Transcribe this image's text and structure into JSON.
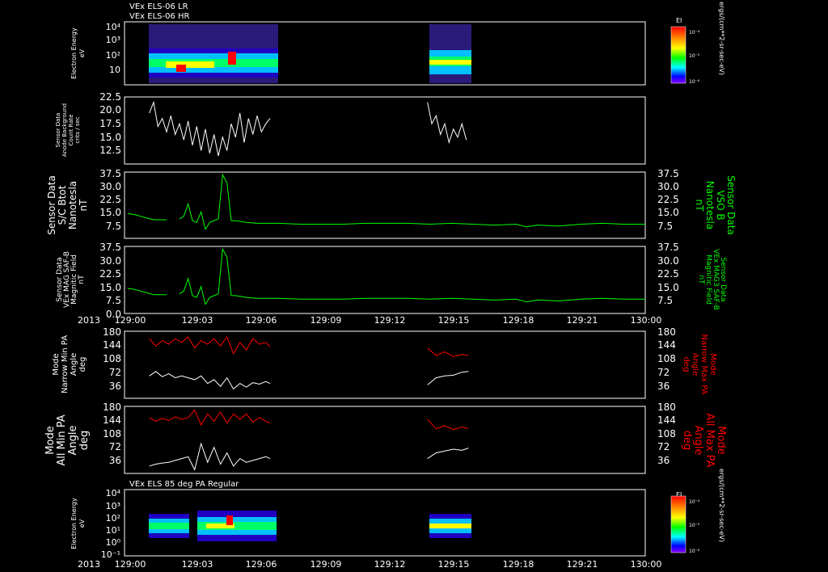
{
  "titles": {
    "top1": "VEx ELS-06 LR",
    "top2": "VEx ELS-06 HR",
    "mid": "VEx ELS 85 deg PA Regular"
  },
  "colors": {
    "white": "#ffffff",
    "green": "#00ff00",
    "red": "#ff0000",
    "background": "#000000"
  },
  "colorbar": {
    "title": "EI",
    "ticks": [
      "10⁻⁴",
      "10⁻⁵",
      "10⁻⁶"
    ],
    "unit_label": "ergs/(cm**2-sr-sec-eV)"
  },
  "time_axis": {
    "year": "2013",
    "ticks": [
      "129:00",
      "129:03",
      "129:06",
      "129:09",
      "129:12",
      "129:15",
      "129:18",
      "129:21",
      "130:00"
    ]
  },
  "chart_data": [
    {
      "type": "heatmap",
      "name": "electron-spectrogram-top",
      "ylabel_lines": [
        "Electron Energy",
        "eV"
      ],
      "y_scale": "log",
      "yticks": [
        "10⁴",
        "10³",
        "10²",
        "10",
        ""
      ],
      "data_intervals": [
        [
          "129:01",
          "129:07"
        ],
        [
          "129:14",
          "129:16"
        ]
      ],
      "colorbar": "EI"
    },
    {
      "type": "line",
      "name": "anode-background",
      "ylabel_lines": [
        "Sensor Data",
        "Anode Background",
        "Count Rate",
        "cnts / sec"
      ],
      "yticks": [
        "22.5",
        "20.0",
        "17.5",
        "15.0",
        "12.5"
      ],
      "ylim": [
        10.0,
        22.5
      ],
      "color": "#ffffff",
      "segments": [
        {
          "t": [
            1.0,
            1.2,
            1.4,
            1.6,
            1.8,
            2.0,
            2.2,
            2.4,
            2.6,
            2.8,
            3.0,
            3.2,
            3.4,
            3.6,
            3.8,
            4.0,
            4.2,
            4.4,
            4.6,
            4.8,
            5.0,
            5.2,
            5.4,
            5.6,
            5.8,
            6.0,
            6.2,
            6.4,
            6.6
          ],
          "v": [
            19.5,
            21.5,
            17.0,
            18.5,
            16.0,
            19.0,
            15.5,
            17.5,
            14.5,
            18.0,
            13.5,
            17.0,
            12.5,
            16.5,
            12.0,
            15.5,
            11.5,
            15.0,
            12.5,
            17.5,
            15.0,
            19.5,
            14.0,
            18.5,
            15.5,
            19.0,
            16.0,
            17.5,
            18.5
          ]
        },
        {
          "t": [
            13.9,
            14.1,
            14.3,
            14.5,
            14.7,
            14.9,
            15.1,
            15.3,
            15.5,
            15.7
          ],
          "v": [
            21.5,
            17.5,
            19.0,
            15.5,
            17.5,
            14.0,
            16.5,
            15.0,
            17.5,
            14.5
          ]
        }
      ]
    },
    {
      "type": "line",
      "name": "sc-btot",
      "ylabel_lines": [
        "Sensor Data",
        "S/C Btot",
        "Nanotesla",
        "nT"
      ],
      "ylabel_right_lines": [
        "Sensor Data",
        "VSO B",
        "Nanotesla",
        "nT"
      ],
      "yticks": [
        "37.5",
        "30.0",
        "22.5",
        "15.0",
        "7.5"
      ],
      "ylim": [
        0,
        37.5
      ],
      "color": "#00ff00",
      "segments": [
        {
          "t": [
            0.0,
            0.3,
            0.6,
            0.9,
            1.2,
            1.5,
            1.8
          ],
          "v": [
            14.0,
            13.5,
            12.5,
            11.5,
            10.5,
            10.5,
            10.5
          ]
        },
        {
          "t": [
            2.4,
            2.6,
            2.8,
            3.0,
            3.2,
            3.4,
            3.6
          ],
          "v": [
            11.0,
            12.5,
            19.5,
            10.0,
            9.0,
            15.0,
            5.0
          ]
        },
        {
          "t": [
            3.6,
            3.8,
            4.0,
            4.2,
            4.4,
            4.6,
            4.8,
            5.0,
            5.5,
            6.0,
            7.0,
            8.0,
            9.0,
            10.0,
            11.0,
            12.0,
            13.0,
            14.0,
            15.0,
            16.0,
            17.0,
            18.0,
            18.5,
            19.0,
            20.0,
            21.0,
            22.0,
            23.0,
            24.0
          ],
          "v": [
            5.0,
            9.0,
            10.0,
            11.0,
            36.0,
            31.5,
            10.0,
            10.0,
            9.0,
            8.5,
            8.5,
            8.0,
            8.0,
            8.0,
            8.5,
            8.5,
            8.5,
            8.0,
            8.5,
            8.0,
            7.5,
            8.0,
            6.5,
            7.5,
            7.0,
            8.0,
            8.5,
            8.0,
            8.0
          ]
        }
      ]
    },
    {
      "type": "line",
      "name": "vex-mag-saf-b",
      "ylabel_lines": [
        "Sensor Data",
        "VEx MAG SAF-B",
        "Magnitic Field",
        "nT"
      ],
      "ylabel_right_lines": [
        "Sensor Data",
        "VEx MAG3 SAF-B",
        "Magnitic Field",
        "nT"
      ],
      "yticks": [
        "37.5",
        "30.0",
        "22.5",
        "15.0",
        "7.5",
        "0.0"
      ],
      "ylim": [
        0,
        37.5
      ],
      "color": "#00ff00",
      "segments": [
        {
          "t": [
            0.0,
            0.3,
            0.6,
            0.9,
            1.2,
            1.5,
            1.8
          ],
          "v": [
            14.0,
            13.5,
            12.5,
            11.5,
            10.5,
            10.5,
            10.5
          ]
        },
        {
          "t": [
            2.4,
            2.6,
            2.8,
            3.0,
            3.2,
            3.4,
            3.6
          ],
          "v": [
            11.0,
            12.5,
            19.5,
            10.0,
            9.0,
            15.0,
            5.0
          ]
        },
        {
          "t": [
            3.6,
            3.8,
            4.0,
            4.2,
            4.4,
            4.6,
            4.8,
            5.0,
            5.5,
            6.0,
            7.0,
            8.0,
            9.0,
            10.0,
            11.0,
            12.0,
            13.0,
            14.0,
            15.0,
            16.0,
            17.0,
            18.0,
            18.5,
            19.0,
            20.0,
            21.0,
            22.0,
            23.0,
            24.0
          ],
          "v": [
            5.0,
            9.0,
            10.0,
            11.0,
            36.0,
            31.5,
            10.0,
            10.0,
            9.0,
            8.5,
            8.5,
            8.0,
            8.0,
            8.0,
            8.5,
            8.5,
            8.5,
            8.0,
            8.5,
            8.0,
            7.5,
            8.0,
            6.5,
            7.5,
            7.0,
            8.0,
            8.5,
            8.0,
            8.0
          ]
        }
      ]
    },
    {
      "type": "line",
      "name": "narrow-pa",
      "ylabel_lines": [
        "Mode",
        "Narrow Min PA",
        "Angle",
        "deg"
      ],
      "ylabel_right_lines": [
        "Mode",
        "Narrow Max PA",
        "Angle",
        "deg"
      ],
      "yticks": [
        "180",
        "144",
        "108",
        "72",
        "36"
      ],
      "ylim": [
        0,
        180
      ],
      "series": [
        {
          "color": "#ffffff",
          "segments": [
            {
              "t": [
                1.0,
                1.3,
                1.6,
                1.9,
                2.2,
                2.5,
                2.8,
                3.1,
                3.4,
                3.7,
                4.0,
                4.3,
                4.6,
                4.9,
                5.2,
                5.5,
                5.8,
                6.1,
                6.4,
                6.6
              ],
              "v": [
                60,
                72,
                58,
                66,
                55,
                60,
                55,
                50,
                60,
                40,
                50,
                32,
                55,
                25,
                40,
                30,
                42,
                38,
                45,
                40
              ]
            },
            {
              "t": [
                13.9,
                14.3,
                14.7,
                15.1,
                15.5,
                15.8
              ],
              "v": [
                36,
                55,
                60,
                62,
                70,
                72
              ]
            }
          ]
        },
        {
          "color": "#ff0000",
          "segments": [
            {
              "t": [
                1.0,
                1.3,
                1.6,
                1.9,
                2.2,
                2.5,
                2.8,
                3.1,
                3.4,
                3.7,
                4.0,
                4.3,
                4.6,
                4.9,
                5.2,
                5.5,
                5.8,
                6.1,
                6.4,
                6.6
              ],
              "v": [
                160,
                140,
                155,
                145,
                160,
                150,
                165,
                135,
                155,
                145,
                160,
                140,
                165,
                120,
                150,
                130,
                160,
                145,
                150,
                138
              ]
            },
            {
              "t": [
                13.9,
                14.3,
                14.7,
                15.1,
                15.5,
                15.8
              ],
              "v": [
                135,
                115,
                125,
                112,
                118,
                115
              ]
            }
          ]
        }
      ]
    },
    {
      "type": "line",
      "name": "all-pa",
      "ylabel_lines": [
        "Mode",
        "All Min PA",
        "Angle",
        "deg"
      ],
      "ylabel_right_lines": [
        "Mode",
        "All Max PA",
        "Angle",
        "deg"
      ],
      "yticks": [
        "180",
        "144",
        "108",
        "72",
        "36"
      ],
      "ylim": [
        0,
        180
      ],
      "series": [
        {
          "color": "#ffffff",
          "segments": [
            {
              "t": [
                1.0,
                1.3,
                1.6,
                1.9,
                2.2,
                2.5,
                2.8,
                3.1,
                3.4,
                3.7,
                4.0,
                4.3,
                4.6,
                4.9,
                5.2,
                5.5,
                5.8,
                6.1,
                6.4,
                6.6
              ],
              "v": [
                20,
                25,
                28,
                30,
                35,
                40,
                45,
                10,
                80,
                30,
                70,
                25,
                55,
                20,
                40,
                30,
                35,
                40,
                45,
                40
              ]
            },
            {
              "t": [
                13.9,
                14.3,
                14.7,
                15.1,
                15.5,
                15.8
              ],
              "v": [
                40,
                55,
                60,
                65,
                62,
                68
              ]
            }
          ]
        },
        {
          "color": "#ff0000",
          "segments": [
            {
              "t": [
                1.0,
                1.3,
                1.6,
                1.9,
                2.2,
                2.5,
                2.8,
                3.1,
                3.4,
                3.7,
                4.0,
                4.3,
                4.6,
                4.9,
                5.2,
                5.5,
                5.8,
                6.1,
                6.4,
                6.6
              ],
              "v": [
                150,
                140,
                148,
                142,
                152,
                145,
                150,
                170,
                130,
                160,
                140,
                165,
                135,
                160,
                145,
                160,
                138,
                150,
                140,
                135
              ]
            },
            {
              "t": [
                13.9,
                14.3,
                14.7,
                15.1,
                15.5,
                15.8
              ],
              "v": [
                145,
                120,
                128,
                118,
                125,
                120
              ]
            }
          ]
        }
      ]
    },
    {
      "type": "heatmap",
      "name": "electron-spectrogram-85deg",
      "ylabel_lines": [
        "Electron Energy",
        "eV"
      ],
      "y_scale": "log",
      "yticks": [
        "10⁴",
        "10³",
        "10²",
        "10¹",
        "10⁰",
        "10⁻¹"
      ],
      "data_intervals": [
        [
          "129:01",
          "129:02"
        ],
        [
          "129:02",
          "129:07"
        ],
        [
          "129:14",
          "129:16"
        ]
      ],
      "colorbar": "EI"
    }
  ]
}
